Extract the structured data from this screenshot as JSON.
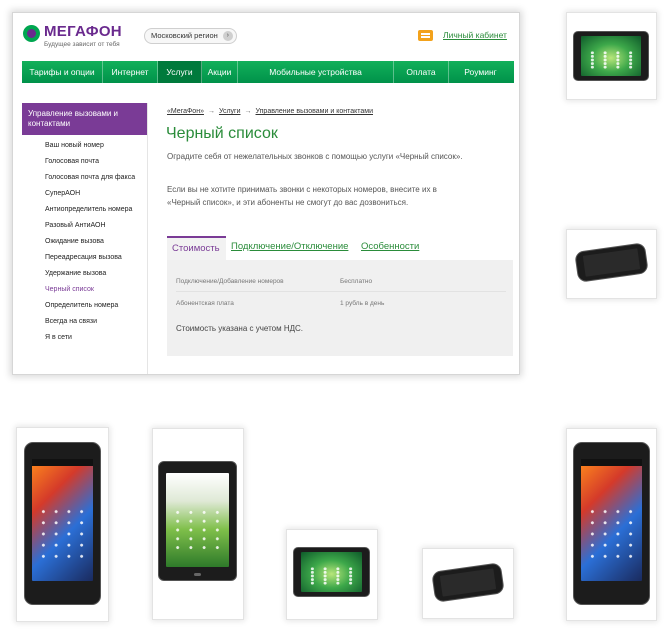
{
  "header": {
    "logo_name": "МЕГАФОН",
    "logo_slogan": "Будущее зависит от тебя",
    "region": "Московский регион",
    "cabinet_link": "Личный кабинет"
  },
  "nav": {
    "items": [
      {
        "label": "Тарифы и опции"
      },
      {
        "label": "Интернет"
      },
      {
        "label": "Услуги",
        "active": true
      },
      {
        "label": "Акции"
      },
      {
        "label": "Мобильные устройства"
      },
      {
        "label": "Оплата"
      },
      {
        "label": "Роуминг"
      }
    ]
  },
  "sidebar": {
    "heading": "Управление вызовами и контактами",
    "items": [
      "Ваш новый номер",
      "Голосовая почта",
      "Голосовая почта для факса",
      "СуперАОН",
      "Антиопределитель номера",
      "Разовый АнтиАОН",
      "Ожидание вызова",
      "Переадресация вызова",
      "Удержание вызова",
      "Черный список",
      "Определитель номера",
      "Всегда на связи",
      "Я в сети"
    ],
    "current_item": "Черный список"
  },
  "breadcrumb": {
    "items": [
      "«МегаФон»",
      "Услуги",
      "Управление вызовами и контактами"
    ],
    "separator": "→"
  },
  "main": {
    "title": "Черный список",
    "paragraph1": "Оградите себя от нежелательных звонков с помощью услуги «Черный список».",
    "paragraph2": "Если вы не хотите принимать звонки с некоторых номеров, внесите их в «Черный список», и эти абоненты не смогут до вас дозвониться.",
    "tabs": [
      "Стоимость",
      "Подключение/Отключение",
      "Особенности"
    ],
    "active_tab": "Стоимость",
    "price_table": [
      {
        "name": "Подключение/Добавление номеров",
        "value": "Бесплатно"
      },
      {
        "name": "Абонентская плата",
        "value": "1 рубль в день"
      }
    ],
    "note": "Стоимость указана с учетом НДС."
  },
  "colors": {
    "brand_green": "#00a650",
    "brand_purple": "#7a3b96",
    "link_green": "#2a8c3a"
  },
  "thumbnails": [
    {
      "device": "tablet-landscape"
    },
    {
      "device": "phone-landscape"
    },
    {
      "device": "smartphone-portrait"
    },
    {
      "device": "tablet-portrait"
    },
    {
      "device": "tablet-landscape"
    },
    {
      "device": "phone-landscape"
    },
    {
      "device": "smartphone-portrait"
    }
  ]
}
